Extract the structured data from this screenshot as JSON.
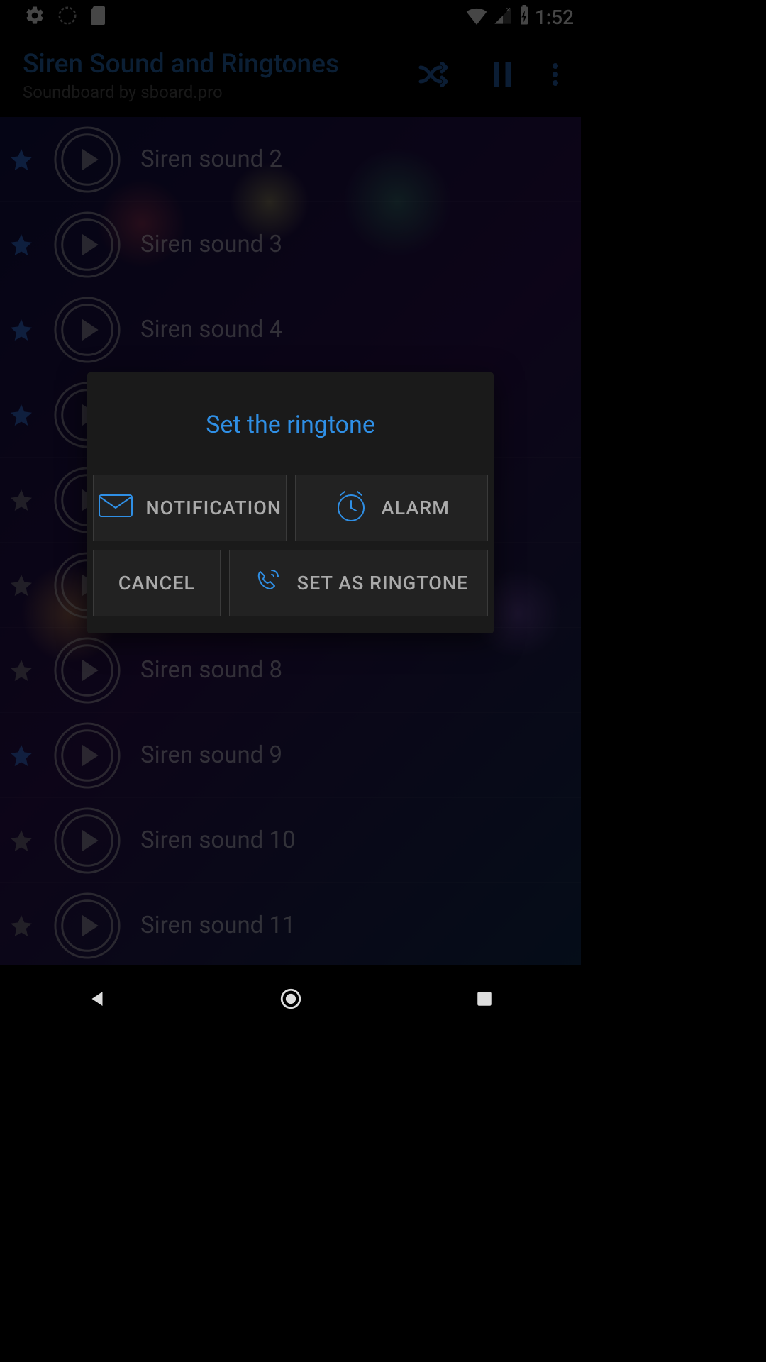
{
  "statusbar": {
    "time": "1:52"
  },
  "header": {
    "title": "Siren Sound and Ringtones",
    "subtitle": "Soundboard by sboard.pro"
  },
  "sounds": [
    {
      "title": "Siren sound 2",
      "favorite": true
    },
    {
      "title": "Siren sound 3",
      "favorite": true
    },
    {
      "title": "Siren sound 4",
      "favorite": true
    },
    {
      "title": "",
      "favorite": true
    },
    {
      "title": "",
      "favorite": false
    },
    {
      "title": "",
      "favorite": false
    },
    {
      "title": "Siren sound 8",
      "favorite": false
    },
    {
      "title": "Siren sound 9",
      "favorite": true
    },
    {
      "title": "Siren sound 10",
      "favorite": false
    },
    {
      "title": "Siren sound 11",
      "favorite": false
    }
  ],
  "modal": {
    "title": "Set the ringtone",
    "notification": "NOTIFICATION",
    "alarm": "ALARM",
    "cancel": "CANCEL",
    "ringtone": "SET AS RINGTONE"
  },
  "colors": {
    "accent": "#2f8fe5",
    "starActive": "#2b6bc0",
    "starInactive": "#6a6a6a",
    "text": "#a8a8a8"
  }
}
